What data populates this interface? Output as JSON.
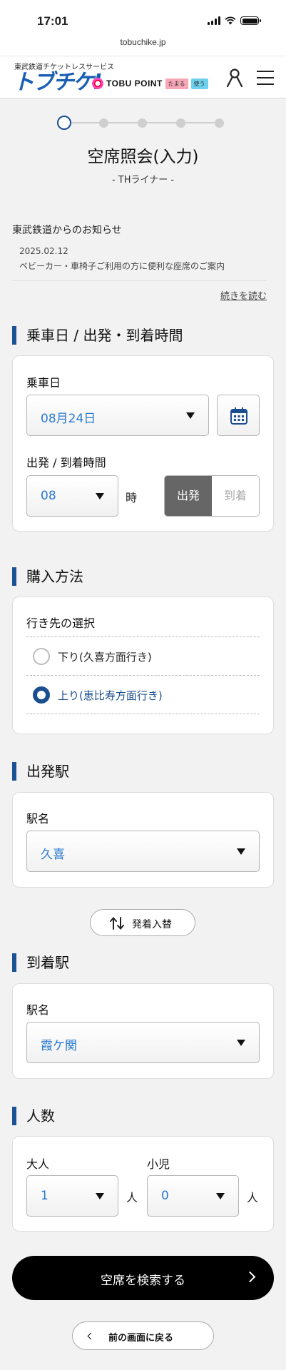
{
  "status": {
    "time": "17:01"
  },
  "browser": {
    "url": "tobuchike.jp"
  },
  "header": {
    "tagline": "東武鉄道チケットレスサービス",
    "logo": "トブチケ!",
    "point_label": "TOBU POINT",
    "point_tag_earn": "たまる",
    "point_tag_use": "使う",
    "icons": [
      "account-icon",
      "hamburger-menu-icon"
    ]
  },
  "steps": {
    "total": 5,
    "current": 1
  },
  "page": {
    "title": "空席照会(入力)",
    "subtitle": "- THライナー -"
  },
  "notice": {
    "heading": "東武鉄道からのお知らせ",
    "date": "2025.02.12",
    "text": "ベビーカー・車椅子ご利用の方に便利な座席のご案内",
    "more": "続きを読む"
  },
  "datetime": {
    "heading": "乗車日 / 出発・到着時間",
    "date_label": "乗車日",
    "date_value": "08月24日",
    "time_label": "出発 / 到着時間",
    "hour_value": "08",
    "hour_unit": "時",
    "depart": "出発",
    "arrive": "到着",
    "selected": "出発"
  },
  "purchase": {
    "heading": "購入方法",
    "direction_label": "行き先の選択",
    "options": [
      {
        "label": "下り(久喜方面行き)",
        "selected": false
      },
      {
        "label": "上り(恵比寿方面行き)",
        "selected": true
      }
    ]
  },
  "departure": {
    "heading": "出発駅",
    "station_label": "駅名",
    "station_value": "久喜"
  },
  "swap": {
    "label": "発着入替"
  },
  "arrival": {
    "heading": "到着駅",
    "station_label": "駅名",
    "station_value": "霞ケ関"
  },
  "passengers": {
    "heading": "人数",
    "adult_label": "大人",
    "adult_value": "1",
    "child_label": "小児",
    "child_value": "0",
    "unit": "人"
  },
  "actions": {
    "search": "空席を検索する",
    "back": "前の画面に戻る"
  },
  "colors": {
    "accent": "#1a5295",
    "value_text": "#2a78d1",
    "primary_button": "#000000"
  }
}
